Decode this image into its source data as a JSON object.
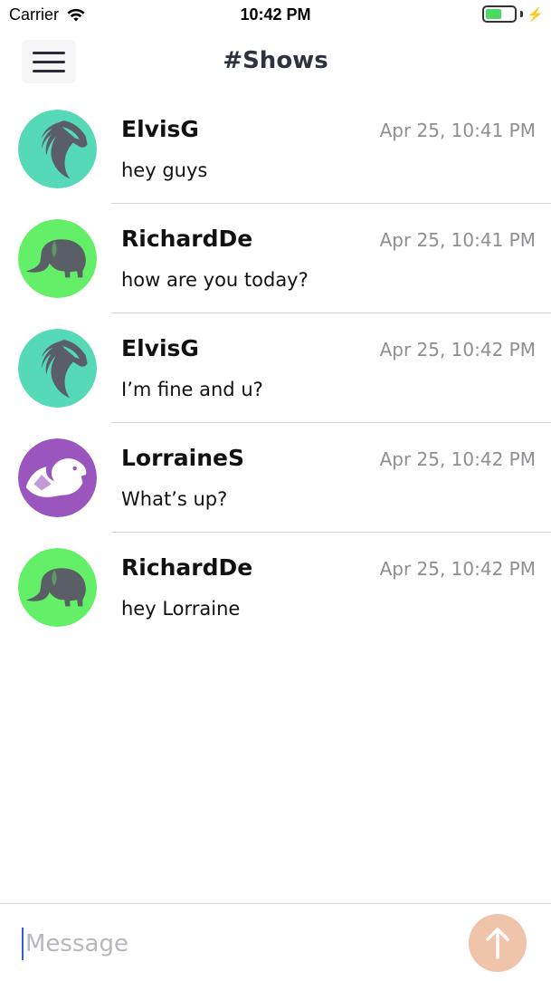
{
  "status_bar": {
    "carrier": "Carrier",
    "time": "10:42 PM",
    "battery_level": 0.55
  },
  "header": {
    "title": "#Shows",
    "menu_icon": "hamburger-menu-icon"
  },
  "messages": [
    {
      "user": "ElvisG",
      "time": "Apr 25, 10:41 PM",
      "text": "hey guys",
      "avatar_icon": "horse-icon",
      "avatar_color": "#55d9b6"
    },
    {
      "user": "RichardDe",
      "time": "Apr 25, 10:41 PM",
      "text": "how are you today?",
      "avatar_icon": "elephant-icon",
      "avatar_color": "#64ef68"
    },
    {
      "user": "ElvisG",
      "time": "Apr 25, 10:42 PM",
      "text": "I’m fine and u?",
      "avatar_icon": "horse-icon",
      "avatar_color": "#55d9b6"
    },
    {
      "user": "LorraineS",
      "time": "Apr 25, 10:42 PM",
      "text": "What’s up?",
      "avatar_icon": "squirrel-icon",
      "avatar_color": "#9b55be"
    },
    {
      "user": "RichardDe",
      "time": "Apr 25, 10:42 PM",
      "text": "hey Lorraine",
      "avatar_icon": "elephant-icon",
      "avatar_color": "#64ef68"
    }
  ],
  "composer": {
    "placeholder": "Message",
    "value": "",
    "send_icon": "arrow-up-icon",
    "send_color": "#f0c4ab"
  }
}
